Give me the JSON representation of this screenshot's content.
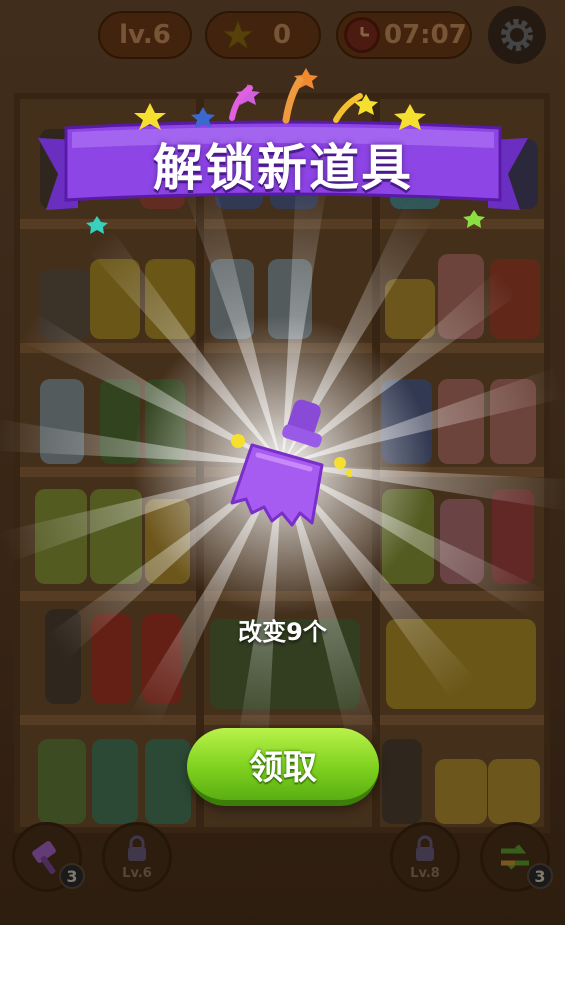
{
  "hud": {
    "level": "lv.6",
    "stars": "0",
    "timer": "07:07"
  },
  "popup": {
    "title": "解锁新道具",
    "reward_text": "改变9个",
    "claim_label": "领取",
    "item_icon": "broom-icon"
  },
  "tools": [
    {
      "icon": "hammer-icon",
      "count": "3"
    },
    {
      "icon": "lock-icon",
      "label": "Lv.6"
    },
    {
      "icon": "lock-icon",
      "label": "Lv.8"
    },
    {
      "icon": "shuffle-icon",
      "count": "3"
    }
  ],
  "colors": {
    "banner": "#8e45e6",
    "button": "#7fd11e",
    "broom": "#a65cf0"
  }
}
